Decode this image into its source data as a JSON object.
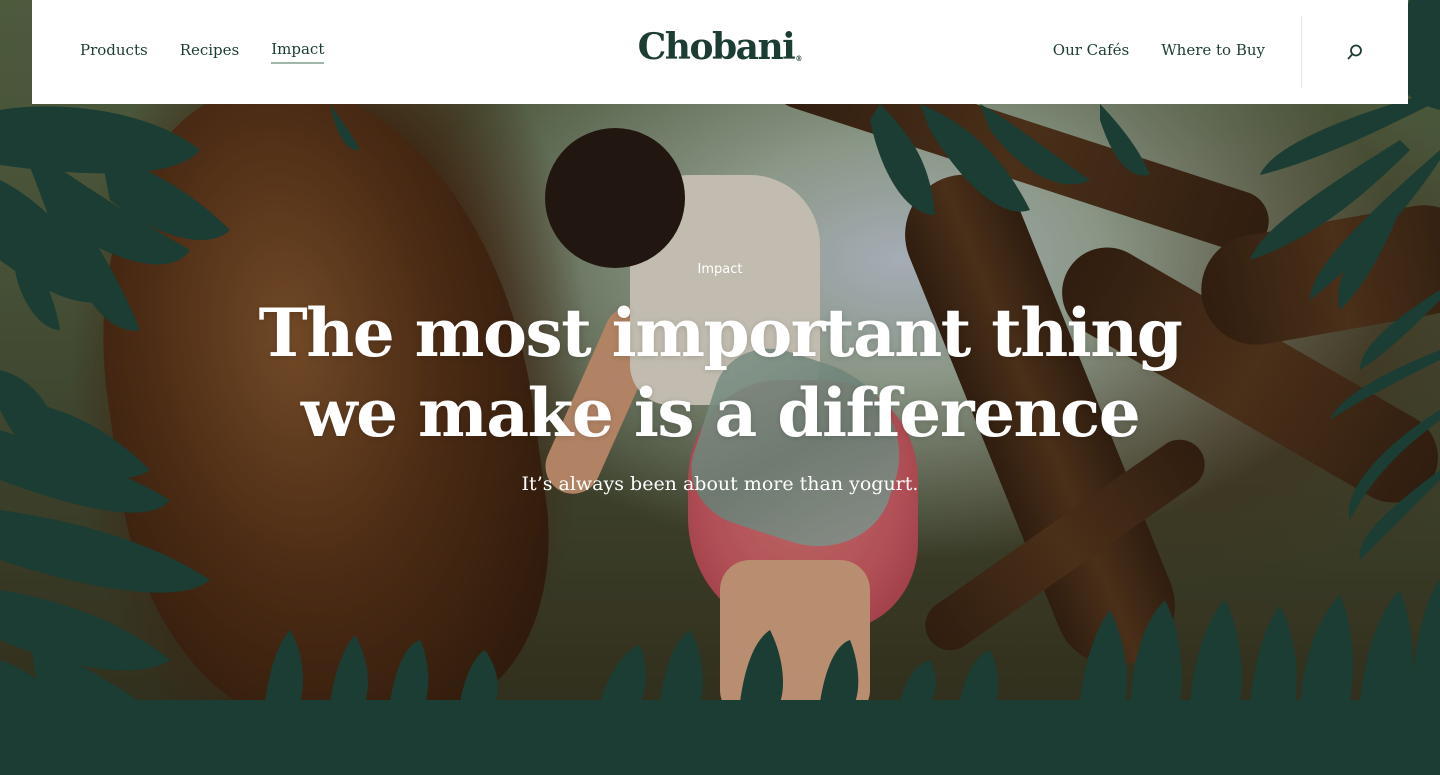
{
  "header": {
    "logo": "Chobani",
    "logo_mark": "®",
    "nav_left": [
      {
        "label": "Products"
      },
      {
        "label": "Recipes"
      },
      {
        "label": "Impact"
      }
    ],
    "nav_right": [
      {
        "label": "Our Cafés"
      },
      {
        "label": "Where to Buy"
      }
    ],
    "search_icon": "search-icon"
  },
  "hero": {
    "eyebrow": "Impact",
    "headline_line1": "The most important thing",
    "headline_line2": "we make is a difference",
    "subhead": "It’s always been about more than yogurt."
  },
  "colors": {
    "brand_green": "#1b3d33",
    "header_bg": "#ffffff",
    "active_underline": "#9fb6a8",
    "hero_text": "#ffffff"
  }
}
